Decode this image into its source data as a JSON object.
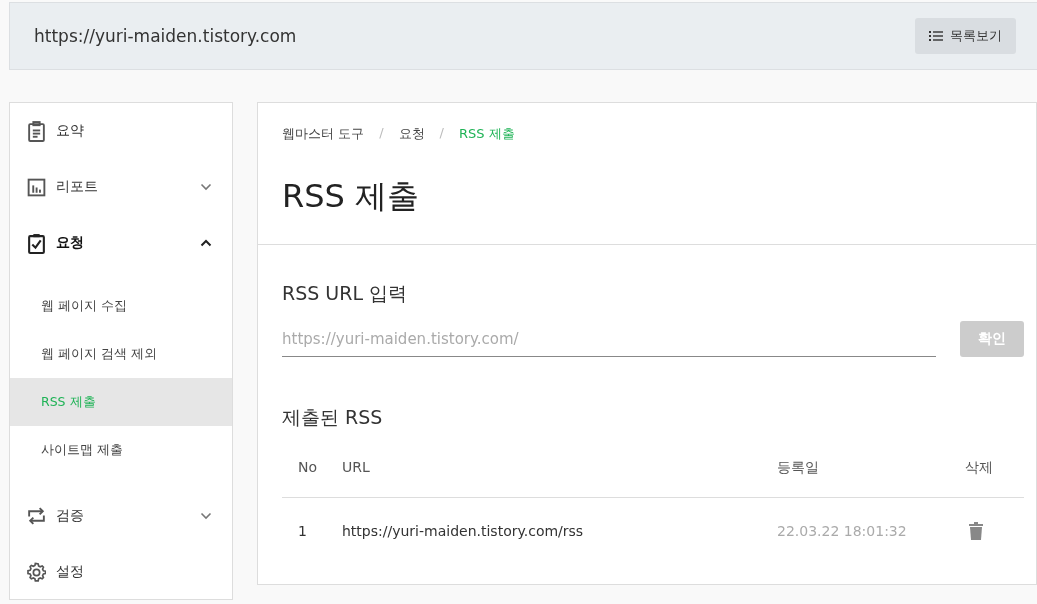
{
  "header": {
    "site_url": "https://yuri-maiden.tistory.com",
    "list_button": "목록보기"
  },
  "sidebar": {
    "items": [
      {
        "label": "요약"
      },
      {
        "label": "리포트",
        "expanded": false
      },
      {
        "label": "요청",
        "expanded": true,
        "children": [
          {
            "label": "웹 페이지 수집",
            "selected": false
          },
          {
            "label": "웹 페이지 검색 제외",
            "selected": false
          },
          {
            "label": "RSS 제출",
            "selected": true
          },
          {
            "label": "사이트맵 제출",
            "selected": false
          }
        ]
      },
      {
        "label": "검증",
        "expanded": false
      },
      {
        "label": "설정"
      }
    ]
  },
  "breadcrumb": {
    "items": [
      "웹마스터 도구",
      "요청",
      "RSS 제출"
    ],
    "separators": [
      "/",
      "/"
    ]
  },
  "page_title": "RSS 제출",
  "form": {
    "heading": "RSS URL 입력",
    "placeholder": "https://yuri-maiden.tistory.com/",
    "submit": "확인"
  },
  "submitted": {
    "heading": "제출된 RSS",
    "columns": [
      "No",
      "URL",
      "등록일",
      "삭제"
    ],
    "rows": [
      {
        "no": "1",
        "url": "https://yuri-maiden.tistory.com/rss",
        "date": "22.03.22 18:01:32"
      }
    ]
  }
}
